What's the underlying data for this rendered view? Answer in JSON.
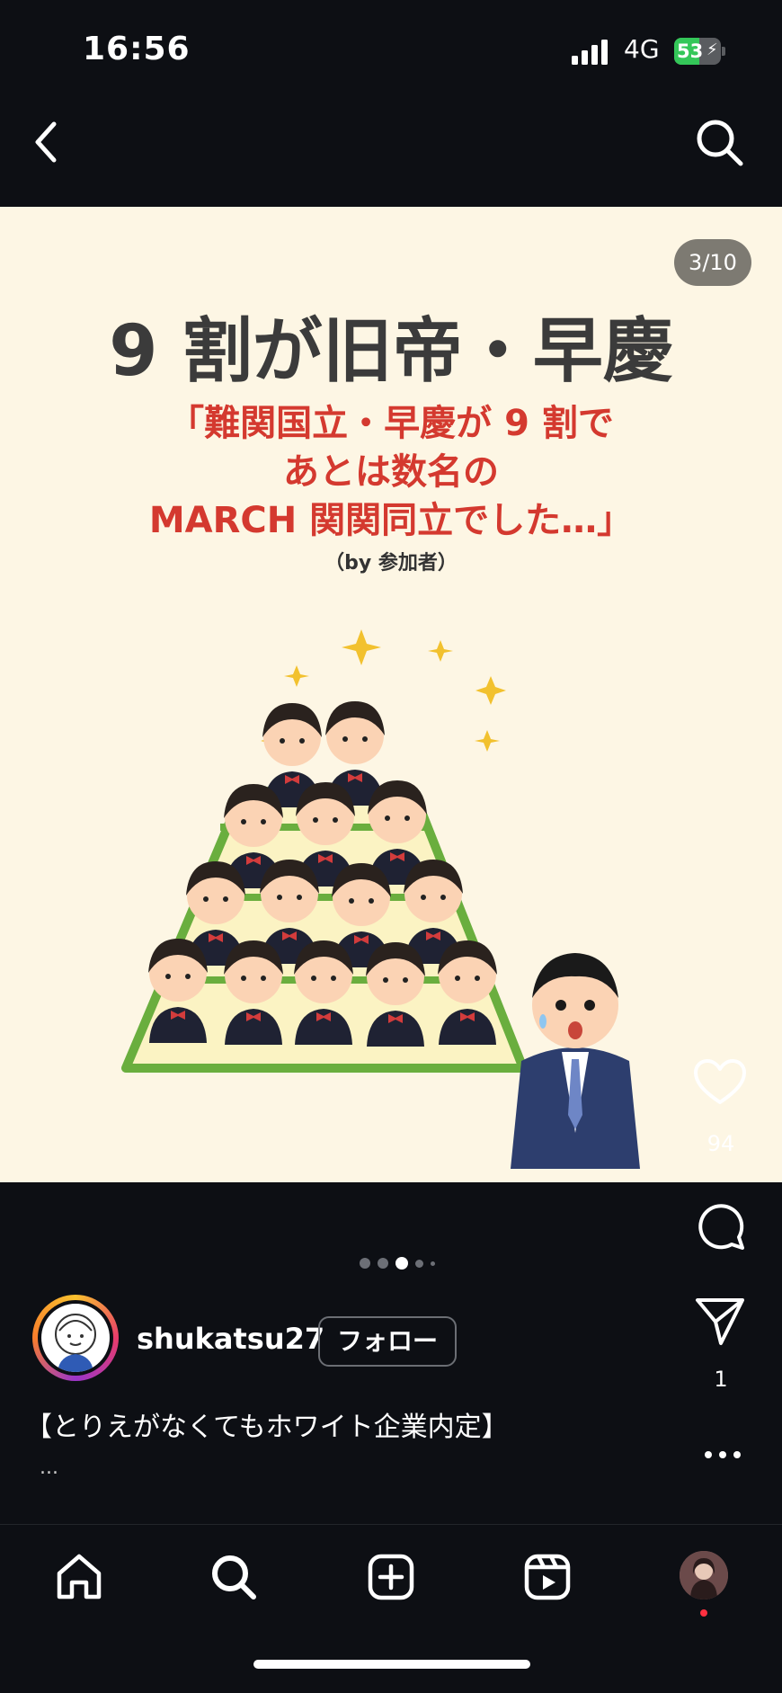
{
  "status_bar": {
    "time": "16:56",
    "network": "4G",
    "battery": "53"
  },
  "post": {
    "page_counter": "3/10",
    "headline": "9 割が旧帝・早慶",
    "quote_lines": [
      "「難関国立・早慶が 9 割で",
      "あとは数名の",
      "MARCH 関関同立でした…」"
    ],
    "attribution": "（by 参加者）",
    "carousel": {
      "current": 3,
      "total_dots": 5
    }
  },
  "actions": {
    "like_count": "94",
    "share_count": "1"
  },
  "author": {
    "username": "shukatsu27",
    "follow_label": "フォロー"
  },
  "caption": {
    "text": "【とりえがなくてもホワイト企業内定】",
    "more": "..."
  },
  "nav": {
    "tabs": [
      "home",
      "search",
      "create",
      "reels",
      "profile"
    ]
  },
  "colors": {
    "background": "#0d0f14",
    "post_bg": "#fdf6e4",
    "quote_red": "#d4392f",
    "headline_gray": "#3b3b3b",
    "battery_green": "#34c759"
  },
  "icons": [
    "back-icon",
    "search-icon",
    "heart-icon",
    "comment-icon",
    "send-icon",
    "more-icon",
    "home-icon",
    "create-icon",
    "reels-icon"
  ]
}
